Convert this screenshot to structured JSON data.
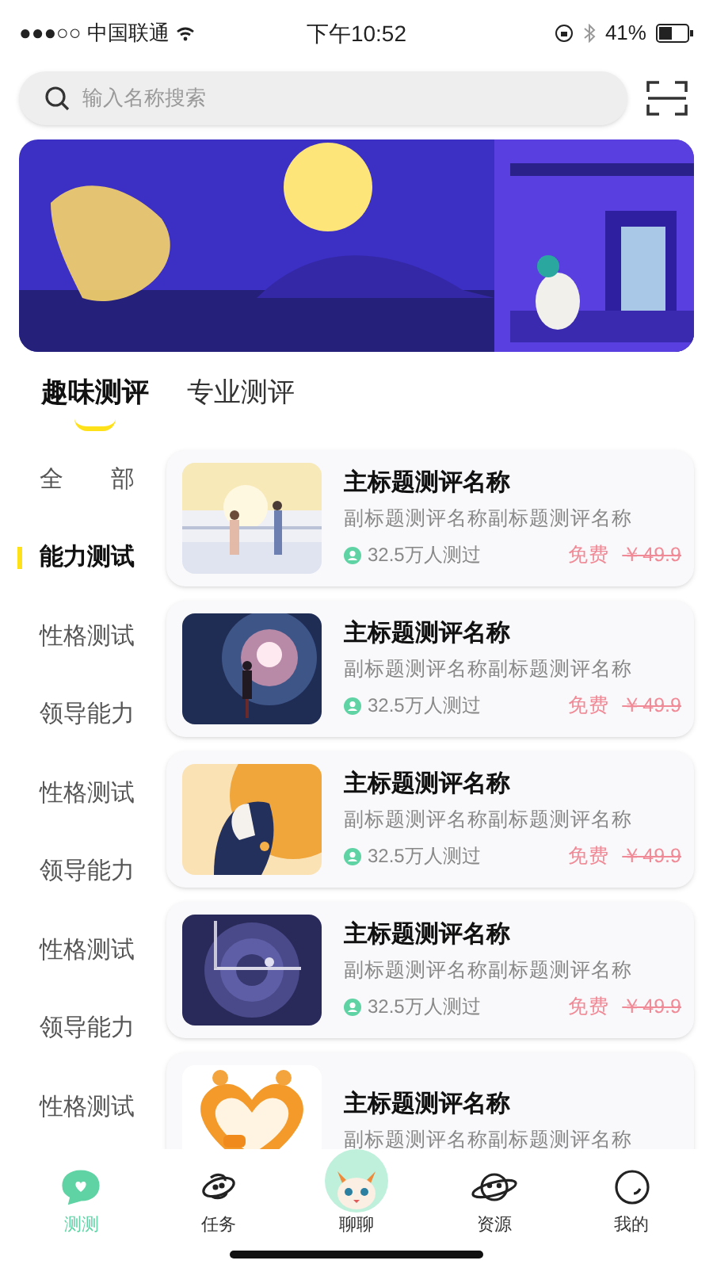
{
  "status_bar": {
    "carrier": "●●●○○ 中国联通",
    "time": "下午10:52",
    "battery": "41%"
  },
  "search": {
    "placeholder": "输入名称搜索"
  },
  "tabs": [
    {
      "label": "趣味测评",
      "selected": true
    },
    {
      "label": "专业测评",
      "selected": false
    }
  ],
  "categories": [
    {
      "label": "全　　部",
      "selected": false
    },
    {
      "label": "能力测试",
      "selected": true
    },
    {
      "label": "性格测试",
      "selected": false
    },
    {
      "label": "领导能力",
      "selected": false
    },
    {
      "label": "性格测试",
      "selected": false
    },
    {
      "label": "领导能力",
      "selected": false
    },
    {
      "label": "性格测试",
      "selected": false
    },
    {
      "label": "领导能力",
      "selected": false
    },
    {
      "label": "性格测试",
      "selected": false
    }
  ],
  "items": [
    {
      "title": "主标题测评名称",
      "subtitle": "副标题测评名称副标题测评名称",
      "count": "32.5万人测过",
      "price": "免费",
      "original_price": "￥49.9"
    },
    {
      "title": "主标题测评名称",
      "subtitle": "副标题测评名称副标题测评名称",
      "count": "32.5万人测过",
      "price": "免费",
      "original_price": "￥49.9"
    },
    {
      "title": "主标题测评名称",
      "subtitle": "副标题测评名称副标题测评名称",
      "count": "32.5万人测过",
      "price": "免费",
      "original_price": "￥49.9"
    },
    {
      "title": "主标题测评名称",
      "subtitle": "副标题测评名称副标题测评名称",
      "count": "32.5万人测过",
      "price": "免费",
      "original_price": "￥49.9"
    },
    {
      "title": "主标题测评名称",
      "subtitle": "副标题测评名称副标题测评名称"
    }
  ],
  "nav": [
    {
      "label": "测测",
      "selected": true,
      "kind": "chat"
    },
    {
      "label": "任务",
      "selected": false,
      "kind": "task"
    },
    {
      "label": "聊聊",
      "selected": false,
      "kind": "mascot"
    },
    {
      "label": "资源",
      "selected": false,
      "kind": "planet"
    },
    {
      "label": "我的",
      "selected": false,
      "kind": "me"
    }
  ]
}
